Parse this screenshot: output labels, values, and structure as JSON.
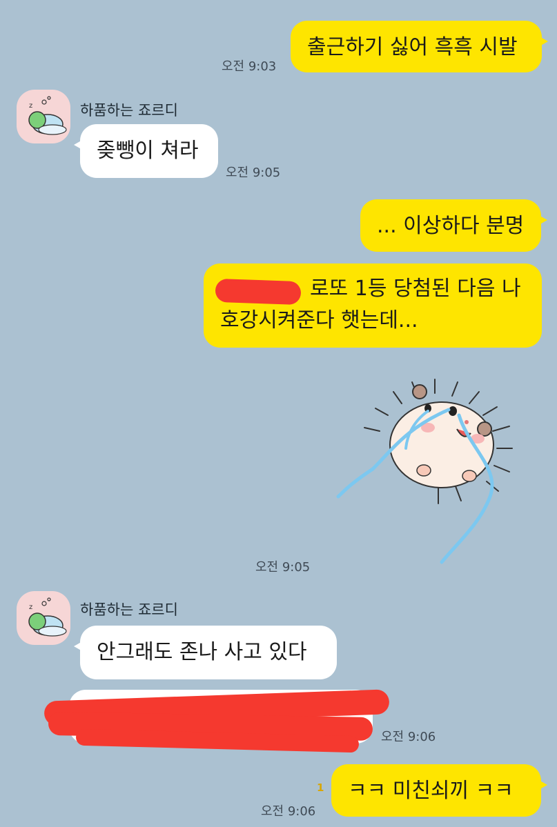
{
  "contact": {
    "name": "하품하는 죠르디",
    "avatar_icon": "sleeping-jordy-avatar-icon"
  },
  "messages": [
    {
      "id": "m1",
      "sender": "me",
      "text": "출근하기 싫어 흑흑 시발",
      "time": "오전 9:03"
    },
    {
      "id": "m2",
      "sender": "them",
      "name": "하품하는 죠르디",
      "text": "좆뺑이 쳐라",
      "time": "오전 9:05"
    },
    {
      "id": "m3",
      "sender": "me",
      "text": "... 이상하다 분명"
    },
    {
      "id": "m4",
      "sender": "me",
      "text_line1": "로또 1등 당첨된 다음 나",
      "text_line2": "호강시켜준다 햇는데..."
    },
    {
      "id": "m5",
      "sender": "me",
      "type": "sticker",
      "sticker": "crying-hedgehog-sticker",
      "time": "오전 9:05"
    },
    {
      "id": "m6",
      "sender": "them",
      "name": "하품하는 죠르디",
      "text": "안그래도 존나 사고 있다"
    },
    {
      "id": "m7",
      "sender": "them",
      "text": "",
      "redacted": true,
      "time": "오전 9:06"
    },
    {
      "id": "m8",
      "sender": "me",
      "text": "ㅋㅋ 미친쇠끼 ㅋㅋ",
      "time": "오전 9:06",
      "unread": "1"
    }
  ],
  "colors": {
    "background": "#abc1d1",
    "my_bubble": "#fee500",
    "their_bubble": "#ffffff",
    "redaction": "#f5392f",
    "sticker_tears": "#7cc8f0"
  }
}
